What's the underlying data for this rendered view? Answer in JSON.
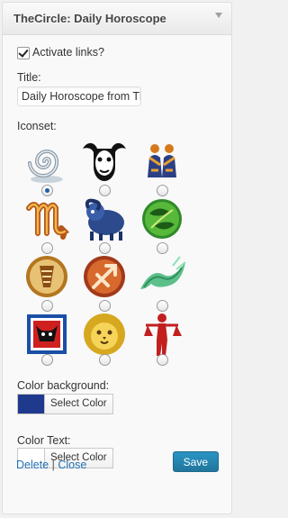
{
  "widget": {
    "title": "TheCircle: Daily Horoscope"
  },
  "form": {
    "activate_links_label": "Activate links?",
    "activate_links_checked": true,
    "title_label": "Title:",
    "title_value": "Daily Horoscope from TheCircle",
    "iconset_label": "Iconset:",
    "iconset_selected_index": 0,
    "iconsets": [
      {
        "icon": "spiral-icon"
      },
      {
        "icon": "bull-skull-icon"
      },
      {
        "icon": "twins-icon"
      },
      {
        "icon": "scorpio-glyph-icon"
      },
      {
        "icon": "ram-creature-icon"
      },
      {
        "icon": "pisces-circle-icon"
      },
      {
        "icon": "aquarius-medallion-icon"
      },
      {
        "icon": "sagittarius-medallion-icon"
      },
      {
        "icon": "green-wave-icon"
      },
      {
        "icon": "taurus-blue-square-icon"
      },
      {
        "icon": "lion-face-icon"
      },
      {
        "icon": "libra-figure-icon"
      }
    ],
    "color_background_label": "Color background:",
    "color_background_value": "#1f3a8c",
    "color_text_label": "Color Text:",
    "color_text_value": "#ffffff",
    "select_color_label": "Select Color"
  },
  "footer": {
    "delete_label": "Delete",
    "separator": "|",
    "close_label": "Close",
    "save_label": "Save"
  }
}
